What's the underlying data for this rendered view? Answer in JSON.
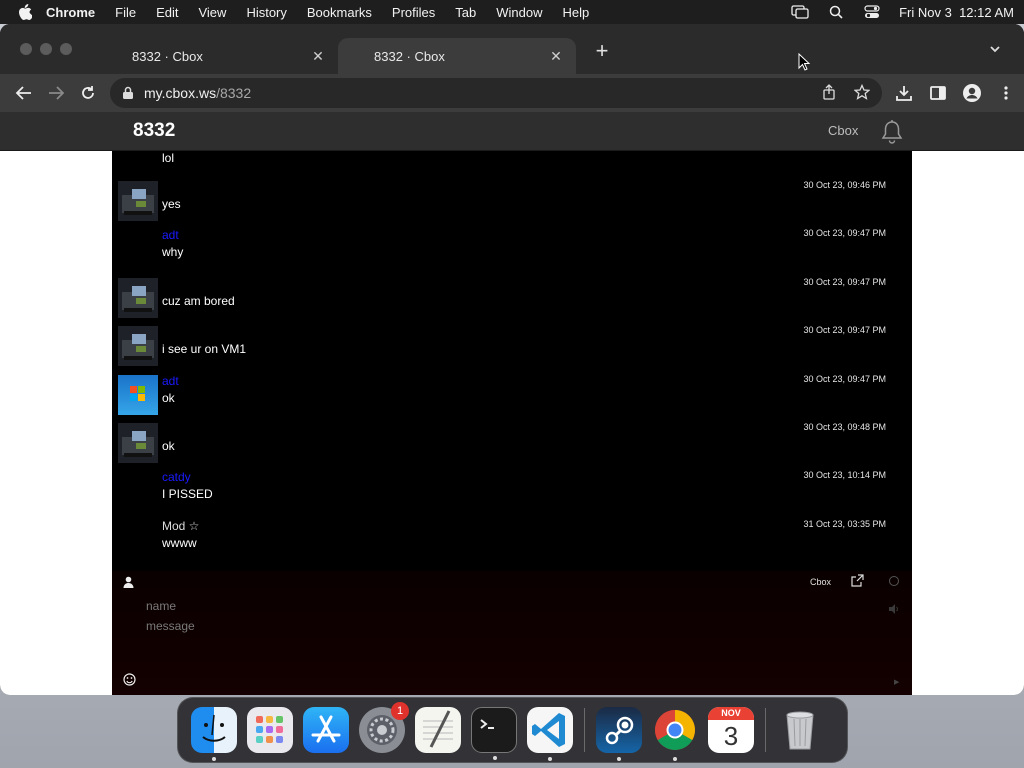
{
  "menubar": {
    "app": "Chrome",
    "items": [
      "File",
      "Edit",
      "View",
      "History",
      "Bookmarks",
      "Profiles",
      "Tab",
      "Window",
      "Help"
    ],
    "clock": "Fri Nov 3  12:12 AM"
  },
  "browser": {
    "tabs": [
      {
        "title": "8332 · Cbox"
      },
      {
        "title": "8332 · Cbox"
      }
    ],
    "url_host": "my.cbox.ws",
    "url_path": "/8332"
  },
  "site": {
    "board_name": "8332",
    "brand": "Cbox"
  },
  "messages": [
    {
      "nick": "",
      "time": "",
      "text": "lol",
      "avatar": "none"
    },
    {
      "nick": "",
      "time": "30 Oct 23, 09:46 PM",
      "text": "yes",
      "avatar": "desk"
    },
    {
      "nick": "adt",
      "time": "30 Oct 23, 09:47 PM",
      "text": "why",
      "avatar": "none"
    },
    {
      "nick": "",
      "time": "30 Oct 23, 09:47 PM",
      "text": "cuz am bored",
      "avatar": "desk"
    },
    {
      "nick": "",
      "time": "30 Oct 23, 09:47 PM",
      "text": "i see ur on VM1",
      "avatar": "desk"
    },
    {
      "nick": "adt",
      "time": "30 Oct 23, 09:47 PM",
      "text": "ok",
      "avatar": "windows"
    },
    {
      "nick": "",
      "time": "30 Oct 23, 09:48 PM",
      "text": "ok",
      "avatar": "desk"
    },
    {
      "nick": "catdy",
      "time": "30 Oct 23, 10:14 PM",
      "text": "I PISSED",
      "avatar": "none"
    },
    {
      "nick": "Mod ☆",
      "time": "31 Oct 23, 03:35 PM",
      "text": "wwww",
      "avatar": "none"
    }
  ],
  "input": {
    "name_placeholder": "name",
    "message_placeholder": "message",
    "cbox_link": "Cbox"
  },
  "dock": {
    "apps": [
      "finder-icon",
      "launchpad-icon",
      "app-store-icon",
      "system-settings-icon",
      "textedit-icon",
      "terminal-icon",
      "vscode-icon",
      "steam-icon",
      "chrome-icon",
      "calendar-icon",
      "trash-icon"
    ],
    "settings_badge": "1",
    "calendar_month": "NOV",
    "calendar_day": "3"
  }
}
